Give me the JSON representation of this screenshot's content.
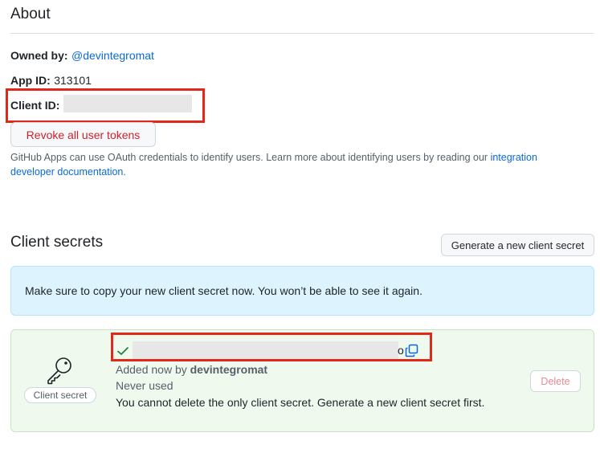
{
  "about": {
    "title": "About",
    "owned_by_label": "Owned by:",
    "owned_by_value": "@devintegromat",
    "app_id_label": "App ID:",
    "app_id_value": "313101",
    "client_id_label": "Client ID:",
    "revoke_button": "Revoke all user tokens",
    "help_text": "GitHub Apps can use OAuth credentials to identify users. Learn more about identifying users by reading our",
    "help_link_part1": "integration",
    "help_link_part2": "developer documentation",
    "help_end": "."
  },
  "client_secrets": {
    "title": "Client secrets",
    "generate_button": "Generate a new client secret",
    "flash_message": "Make sure to copy your new client secret now. You won’t be able to see it again.",
    "secret_badge": "Client secret",
    "added_prefix": "Added now by ",
    "added_by": "devintegromat",
    "last_used": "Never used",
    "delete_note": "You cannot delete the only client secret. Generate a new client secret first.",
    "delete_button": "Delete",
    "secret_suffix_char": "o"
  },
  "colors": {
    "highlight_outline": "#e0281b",
    "link": "#0969da",
    "danger": "#cf222e",
    "success_check": "#1a7f37"
  },
  "icons": {
    "key": "key-icon",
    "check": "check-icon",
    "copy": "copy-icon"
  }
}
